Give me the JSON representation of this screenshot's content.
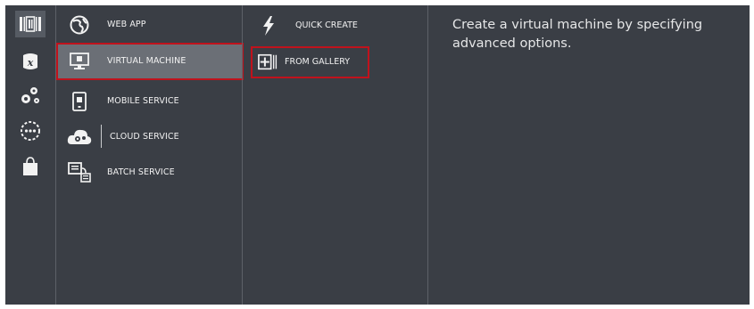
{
  "rail": {
    "items": [
      {
        "icon": "all-items-icon",
        "active": true
      },
      {
        "icon": "sql-database-icon"
      },
      {
        "icon": "cloud-services-gears-icon"
      },
      {
        "icon": "networking-circle-icon"
      },
      {
        "icon": "store-bag-icon"
      }
    ]
  },
  "services": {
    "items": [
      {
        "label": "WEB APP",
        "icon": "web-app-globe-icon"
      },
      {
        "label": "VIRTUAL MACHINE",
        "icon": "virtual-machine-monitor-icon",
        "selected": true
      },
      {
        "label": "MOBILE SERVICE",
        "icon": "mobile-service-icon"
      },
      {
        "label": "CLOUD SERVICE",
        "icon": "cloud-service-icon"
      },
      {
        "label": "BATCH SERVICE",
        "icon": "batch-service-icon"
      }
    ]
  },
  "options": {
    "items": [
      {
        "label": "QUICK CREATE",
        "icon": "lightning-bolt-icon"
      },
      {
        "label": "FROM GALLERY",
        "icon": "add-box-icon",
        "highlighted": true
      }
    ]
  },
  "description": {
    "text": "Create a virtual machine by specifying advanced options."
  },
  "colors": {
    "background": "#3a3e45",
    "selected": "#6b6f76",
    "highlight_border": "#c0121c",
    "text": "#f2f2f2"
  }
}
